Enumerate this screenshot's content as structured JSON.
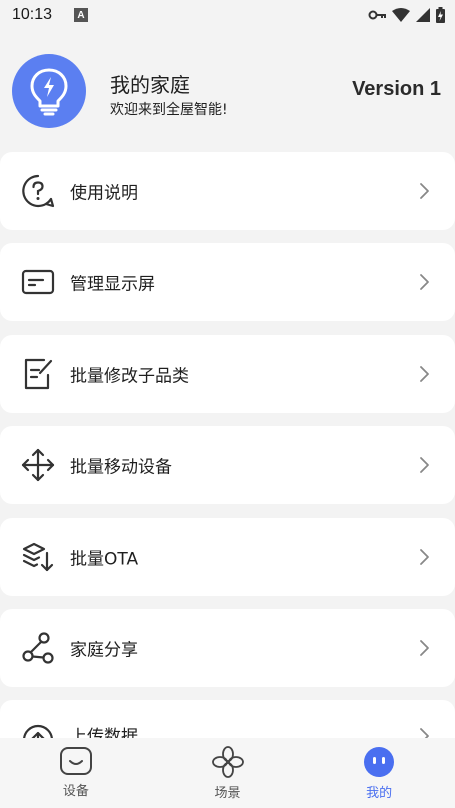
{
  "status_bar": {
    "time": "10:13",
    "notification_icon": "A"
  },
  "header": {
    "title": "我的家庭",
    "subtitle": "欢迎来到全屋智能!",
    "version": "Version 1",
    "avatar_icon": "lightbulb-icon",
    "accent_color": "#5b7ff1"
  },
  "menu": {
    "items": [
      {
        "label": "使用说明",
        "icon": "help-icon"
      },
      {
        "label": "管理显示屏",
        "icon": "display-icon"
      },
      {
        "label": "批量修改子品类",
        "icon": "edit-note-icon"
      },
      {
        "label": "批量移动设备",
        "icon": "move-icon"
      },
      {
        "label": "批量OTA",
        "icon": "ota-icon"
      },
      {
        "label": "家庭分享",
        "icon": "share-icon"
      },
      {
        "label": "上传数据",
        "icon": "upload-icon"
      }
    ]
  },
  "tabbar": {
    "tabs": [
      {
        "label": "设备",
        "icon": "device-icon"
      },
      {
        "label": "场景",
        "icon": "scene-icon"
      },
      {
        "label": "我的",
        "icon": "profile-icon",
        "active": true
      }
    ],
    "active_color": "#4a6ff0"
  }
}
